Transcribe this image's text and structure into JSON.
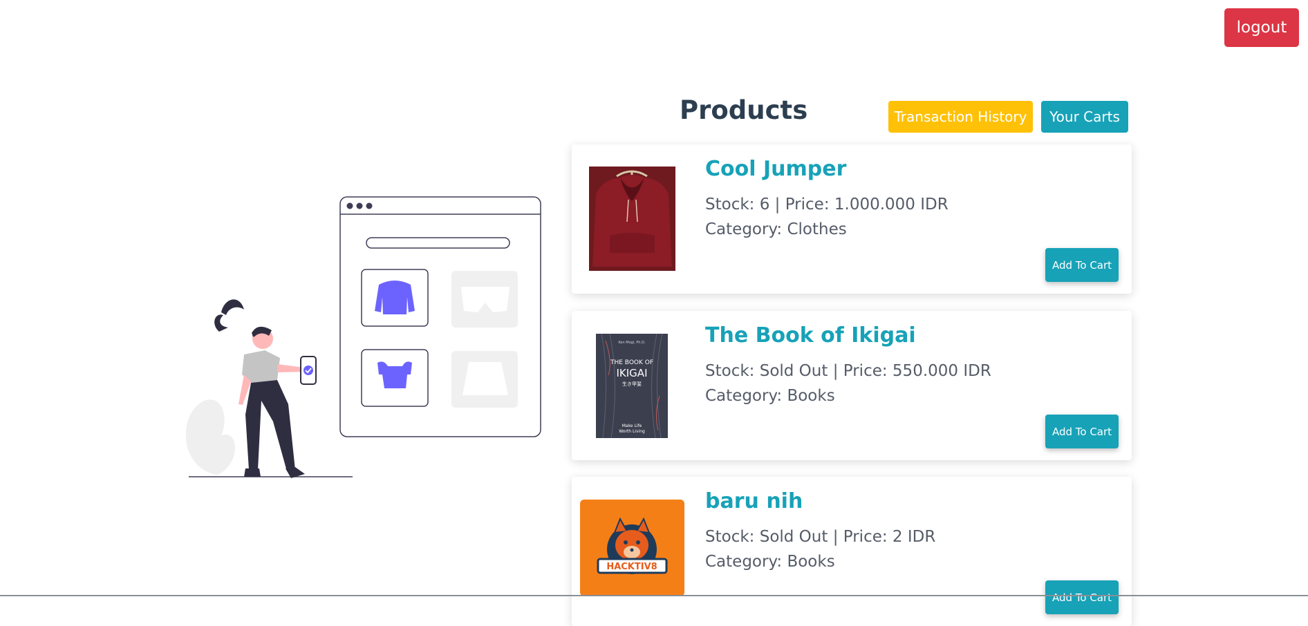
{
  "header": {
    "logout_label": "logout"
  },
  "main": {
    "title": "Products",
    "transaction_history_label": "Transaction History",
    "your_carts_label": "Your Carts"
  },
  "products": [
    {
      "name": "Cool Jumper",
      "stock_line": "Stock: 6 | Price: 1.000.000 IDR",
      "category_line": "Category: Clothes",
      "add_label": "Add To Cart",
      "image": "maroon-hoodie"
    },
    {
      "name": "The Book of Ikigai",
      "stock_line": "Stock: Sold Out | Price: 550.000 IDR",
      "category_line": "Category: Books",
      "add_label": "Add To Cart",
      "image": "ikigai-book-cover",
      "cover": {
        "top": "Ken Mogi, Ph.D.",
        "line1": "THE BOOK OF",
        "line2": "IKIGAI",
        "line3": "生き甲斐",
        "bottom1": "Make Life",
        "bottom2": "Worth Living"
      }
    },
    {
      "name": "baru nih",
      "stock_line": "Stock: Sold Out | Price: 2 IDR",
      "category_line": "Category: Books",
      "add_label": "Add To Cart",
      "image": "hacktiv8-logo",
      "logo_text": "HACKTIV8"
    }
  ],
  "colors": {
    "danger": "#dc3545",
    "warning": "#ffc107",
    "info": "#17a2b8",
    "heading": "#2c3e50",
    "accent": "#6c63ff"
  }
}
